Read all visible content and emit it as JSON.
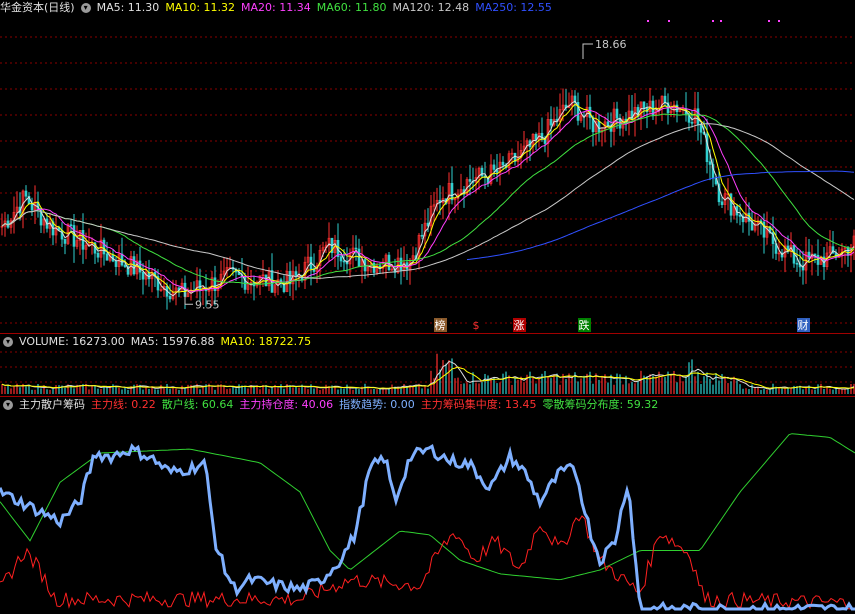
{
  "price_panel": {
    "title": "华金资本(日线)",
    "ma_labels": [
      {
        "text": "MA5: 11.30",
        "color": "#e0e0e0"
      },
      {
        "text": "MA10: 11.32",
        "color": "#ffff00"
      },
      {
        "text": "MA20: 11.34",
        "color": "#ff40ff"
      },
      {
        "text": "MA60: 11.80",
        "color": "#40e040"
      },
      {
        "text": "MA120: 12.48",
        "color": "#c8c8c8"
      },
      {
        "text": "MA250: 12.55",
        "color": "#3050ff"
      }
    ],
    "high_label": "18.66",
    "low_label": "9.55",
    "event_markers": [
      {
        "text": "榜",
        "color": "#ffffff",
        "bg": "#8b5a2b"
      },
      {
        "text": "$",
        "color": "#ff3030",
        "bg": "#000000"
      },
      {
        "text": "涨",
        "color": "#ffffff",
        "bg": "#b00000"
      },
      {
        "text": "跌",
        "color": "#ffffff",
        "bg": "#008000"
      },
      {
        "text": "财",
        "color": "#ffffff",
        "bg": "#3060c0"
      }
    ]
  },
  "volume_panel": {
    "labels": [
      {
        "text": "VOLUME: 16273.00",
        "color": "#e0e0e0"
      },
      {
        "text": "MA5: 15976.88",
        "color": "#e0e0e0"
      },
      {
        "text": "MA10: 18722.75",
        "color": "#ffff00"
      }
    ]
  },
  "indicator_panel": {
    "name": "主力散户筹码",
    "labels": [
      {
        "text": "主力线: 0.22",
        "color": "#ff3030"
      },
      {
        "text": "散户线: 60.64",
        "color": "#40e040"
      },
      {
        "text": "主力持仓度: 40.06",
        "color": "#ff40ff"
      },
      {
        "text": "指数趋势: 0.00",
        "color": "#7fb0ff"
      },
      {
        "text": "主力筹码集中度: 13.45",
        "color": "#ff3030"
      },
      {
        "text": "零散筹码分布度: 59.32",
        "color": "#40e040"
      }
    ]
  },
  "chart_data": [
    {
      "type": "line",
      "name": "price",
      "high": 18.66,
      "low": 9.55,
      "ylim": [
        9.0,
        19.5
      ],
      "grid": true,
      "legend": "top-left"
    },
    {
      "type": "bar",
      "name": "volume",
      "grid": true,
      "legend": "top-left"
    },
    {
      "type": "line",
      "name": "indicator",
      "ylim": [
        0,
        100
      ],
      "series": [
        {
          "name": "主力线",
          "color": "#ff2020"
        },
        {
          "name": "散户线",
          "color": "#30d030"
        },
        {
          "name": "指数趋势",
          "color": "#7fb0ff"
        }
      ],
      "grid": false,
      "legend": "top-left"
    }
  ]
}
